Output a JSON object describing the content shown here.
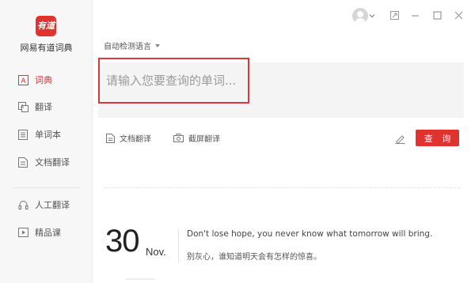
{
  "app": {
    "logo_text": "有道",
    "name": "网易有道词典"
  },
  "sidebar": {
    "items": [
      {
        "label": "词典",
        "icon": "dictionary-icon",
        "active": true
      },
      {
        "label": "翻译",
        "icon": "translate-icon",
        "active": false
      },
      {
        "label": "单词本",
        "icon": "wordbook-icon",
        "active": false
      },
      {
        "label": "文档翻译",
        "icon": "document-translate-icon",
        "active": false
      },
      {
        "label": "人工翻译",
        "icon": "human-translate-icon",
        "active": false
      },
      {
        "label": "精品课",
        "icon": "course-icon",
        "active": false
      }
    ]
  },
  "search": {
    "language": "自动检测语言",
    "placeholder": "请输入您要查询的单词..."
  },
  "tools": {
    "doc_translate": "文档翻译",
    "screenshot_translate": "截屏翻译",
    "query_button": "查 询"
  },
  "daily": {
    "day": "30",
    "month": "Nov.",
    "quote_en": "Don't lose hope, you never know what tomorrow will bring.",
    "quote_zh": "别灰心，谁知道明天会有怎样的惊喜。"
  },
  "colors": {
    "accent": "#e0322f"
  }
}
